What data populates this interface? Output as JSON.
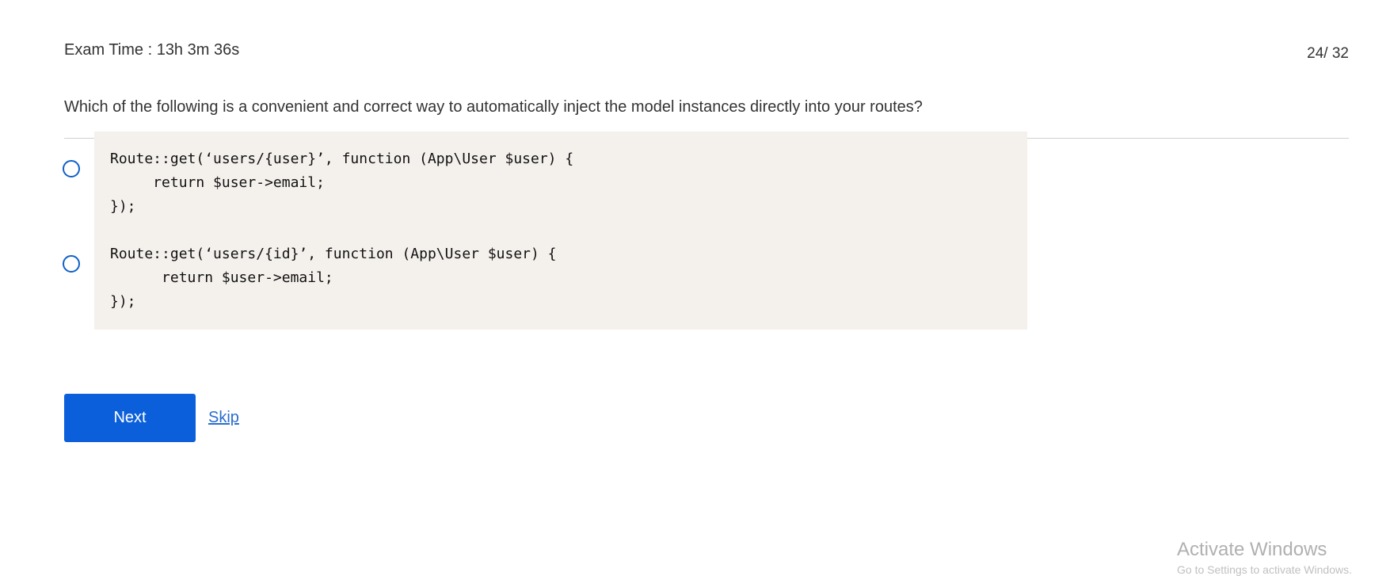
{
  "header": {
    "timer_text": "Exam Time : 13h 3m 36s",
    "progress_text": "24/ 32"
  },
  "question": {
    "text": "Which of the following is a convenient and correct way to automatically inject the model instances directly into your routes?"
  },
  "options": [
    {
      "code": "Route::get(‘users/{user}’, function (App\\User $user) {\n     return $user->email;\n});",
      "selected": false
    },
    {
      "code": "Route::get(‘users/{id}’, function (App\\User $user) {\n      return $user->email;\n});",
      "selected": false
    }
  ],
  "actions": {
    "next_label": "Next",
    "skip_label": "Skip"
  },
  "watermark": {
    "title": "Activate Windows",
    "subtitle": "Go to Settings to activate Windows."
  },
  "colors": {
    "accent": "#0b5fdb",
    "radio_border": "#1060c9",
    "code_background": "#f4f1ed",
    "link": "#2a6ccf"
  }
}
